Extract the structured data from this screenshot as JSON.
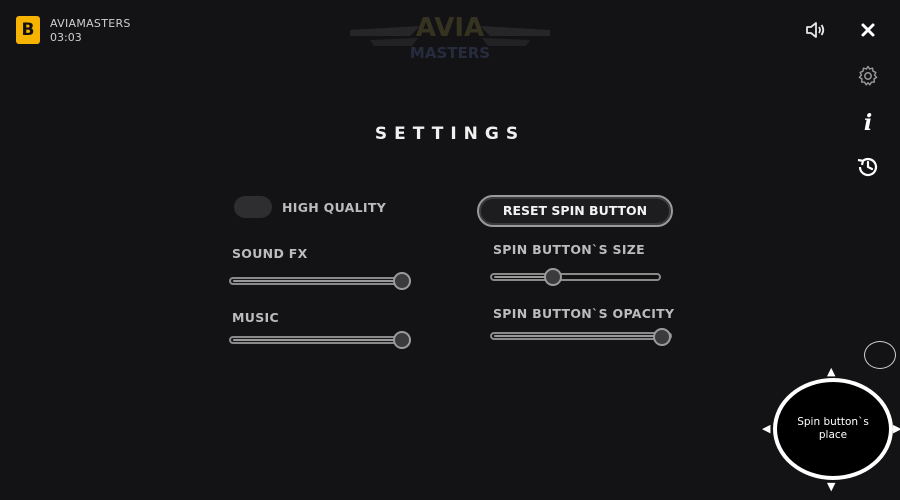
{
  "header": {
    "brand_letter": "B",
    "game_name": "AVIAMASTERS",
    "time": "03:03",
    "logo_line1": "AVIA",
    "logo_line2": "MASTERS"
  },
  "toolbar": {
    "sound_icon": "speaker-icon",
    "close_icon": "close-icon",
    "settings_icon": "gear-icon",
    "info_icon": "info-icon",
    "history_icon": "history-icon",
    "info_glyph": "i"
  },
  "settings": {
    "title": "SETTINGS",
    "high_quality_label": "HIGH QUALITY",
    "high_quality_on": false,
    "sound_fx_label": "SOUND FX",
    "sound_fx_level": 1.0,
    "music_label": "MUSIC",
    "music_level": 1.0,
    "reset_spin_label": "RESET SPIN BUTTON",
    "spin_size_label": "SPIN BUTTON`S SIZE",
    "spin_size_level": 0.36,
    "spin_opacity_label": "SPIN BUTTON`S OPACITY",
    "spin_opacity_level": 1.0
  },
  "spin": {
    "place_text": "Spin button`s place"
  },
  "colors": {
    "background": "#131315",
    "brand": "#f6b400"
  }
}
